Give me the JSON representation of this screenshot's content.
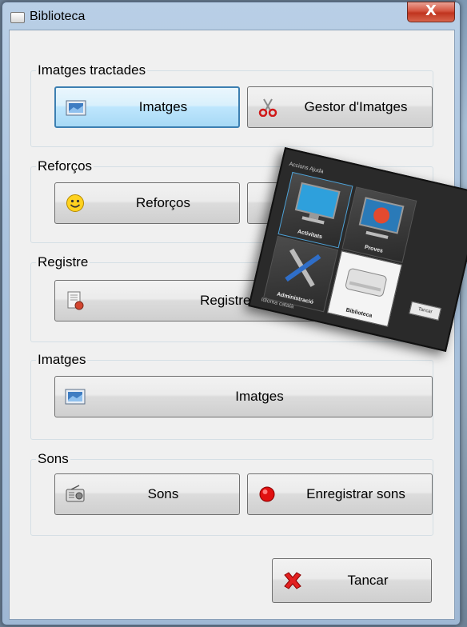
{
  "window": {
    "title": "Biblioteca",
    "close_glyph": "X"
  },
  "groups": {
    "treated": {
      "legend": "Imatges tractades",
      "images_button": "Imatges",
      "manager_button": "Gestor d'Imatges"
    },
    "reinforcements": {
      "legend": "Reforços",
      "button": "Reforços"
    },
    "log": {
      "legend": "Registre",
      "button": "Registre d'Activitats"
    },
    "images": {
      "legend": "Imatges",
      "button": "Imatges"
    },
    "sounds": {
      "legend": "Sons",
      "sounds_button": "Sons",
      "record_button": "Enregistrar sons"
    }
  },
  "cancel_button": "Tancar",
  "overlay": {
    "menu": "Accions   Ajuda",
    "tiles": [
      "Activitats",
      "Proves",
      "Administració",
      "Biblioteca"
    ],
    "cancel": "Tancar",
    "language": "Idioma  català"
  },
  "icons": {
    "images": "image-icon",
    "manager": "scissors-icon",
    "reinforcement": "smiley-icon",
    "log": "document-icon",
    "sounds": "radio-icon",
    "record": "record-dot-icon",
    "cancel": "red-x-icon"
  },
  "colors": {
    "accent": "#3c7fb1",
    "close": "#c0341e"
  }
}
